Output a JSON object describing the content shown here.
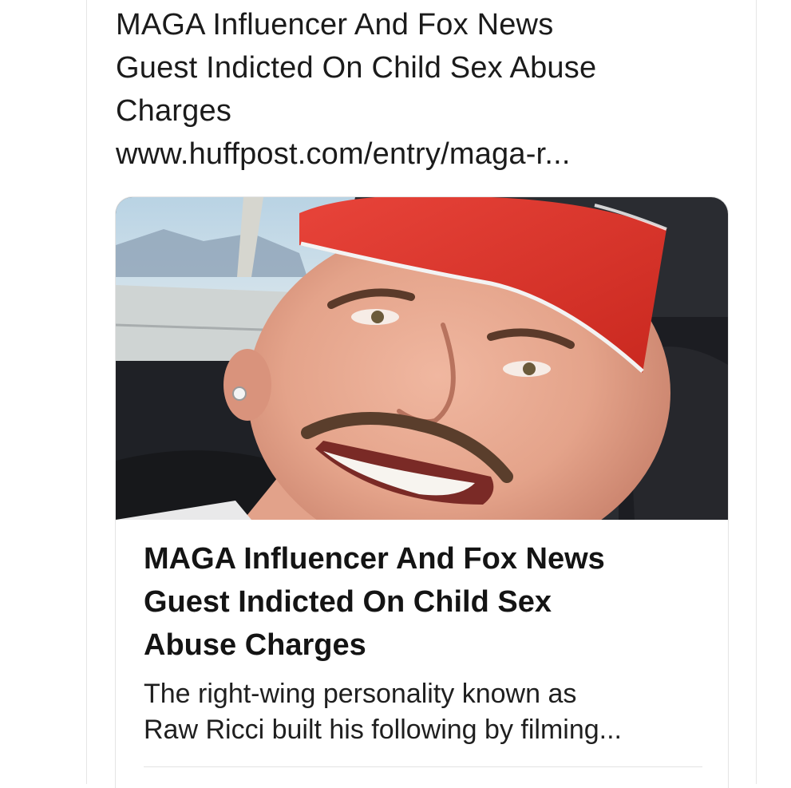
{
  "post": {
    "text_lines": [
      "MAGA Influencer And Fox News",
      "Guest Indicted On Child Sex Abuse",
      "Charges"
    ],
    "link": "www.huffpost.com/entry/maga-r..."
  },
  "link_card": {
    "title_lines": [
      "MAGA Influencer And Fox News",
      "Guest Indicted On Child Sex",
      "Abuse Charges"
    ],
    "description_lines": [
      "The right-wing personality known as",
      "Raw Ricci built his following by filming..."
    ]
  },
  "colors": {
    "cap_red": "#d8322c",
    "text": "#1b1b1b",
    "divider": "#e4e4e4"
  }
}
